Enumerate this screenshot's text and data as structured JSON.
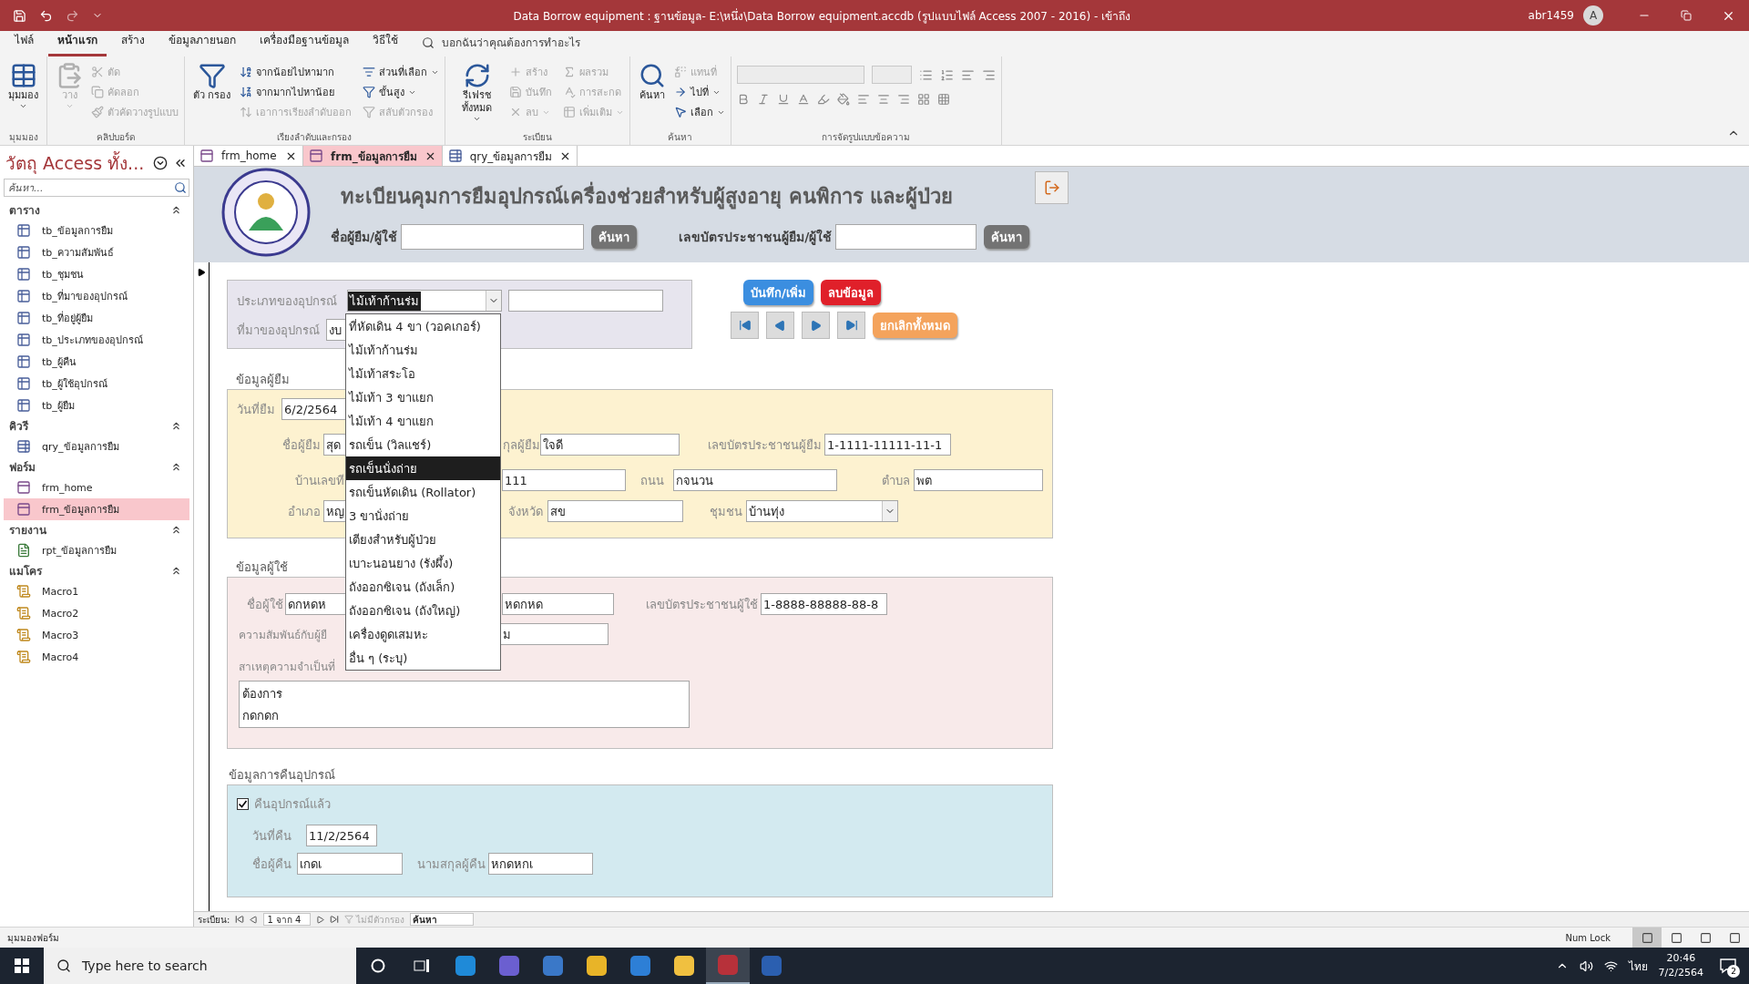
{
  "title_bar": {
    "title": "Data Borrow equipment : ฐานข้อมูล- E:\\หนึ่ง\\Data Borrow equipment.accdb (รูปแบบไฟล์ Access 2007 - 2016)  -  เข้าถึง",
    "user": "abr1459",
    "avatar": "A"
  },
  "ribbon": {
    "tabs": [
      {
        "label": "ไฟล์",
        "selected": false
      },
      {
        "label": "หน้าแรก",
        "selected": true
      },
      {
        "label": "สร้าง",
        "selected": false
      },
      {
        "label": "ข้อมูลภายนอก",
        "selected": false
      },
      {
        "label": "เครื่องมือฐานข้อมูล",
        "selected": false
      },
      {
        "label": "วิธีใช้",
        "selected": false
      }
    ],
    "tell_me": "บอกฉันว่าคุณต้องการทำอะไร",
    "groups": [
      {
        "label": "มุมมอง",
        "items": [
          {
            "kind": "large",
            "label": "มุมมอง",
            "disabled": false,
            "menu": true
          }
        ]
      },
      {
        "label": "คลิปบอร์ด",
        "items": [
          {
            "kind": "large",
            "label": "วาง",
            "disabled": true,
            "menu": true
          },
          {
            "kind": "small",
            "label": "ตัด",
            "disabled": true,
            "menu": false
          },
          {
            "kind": "small",
            "label": "คัดลอก",
            "disabled": true,
            "menu": false
          },
          {
            "kind": "small",
            "label": "ตัวคัดวางรูปแบบ",
            "disabled": true,
            "menu": false
          }
        ]
      },
      {
        "label": "เรียงลำดับและกรอง",
        "items": [
          {
            "kind": "large",
            "label": "ตัว กรอง",
            "disabled": false,
            "menu": false
          },
          {
            "kind": "small",
            "label": "จากน้อยไปหามาก",
            "disabled": false,
            "menu": false
          },
          {
            "kind": "small",
            "label": "จากมากไปหาน้อย",
            "disabled": false,
            "menu": false
          },
          {
            "kind": "small",
            "label": "เอาการเรียงลำดับออก",
            "disabled": true,
            "menu": false
          },
          {
            "kind": "small",
            "label": "ส่วนที่เลือก",
            "disabled": false,
            "menu": true
          },
          {
            "kind": "small",
            "label": "ขั้นสูง",
            "disabled": false,
            "menu": true
          },
          {
            "kind": "small",
            "label": "สลับตัวกรอง",
            "disabled": true,
            "menu": false
          }
        ]
      },
      {
        "label": "ระเบียน",
        "items": [
          {
            "kind": "large",
            "label": "รีเฟรช ทั้งหมด",
            "disabled": false,
            "menu": true
          },
          {
            "kind": "small",
            "label": "สร้าง",
            "disabled": true,
            "menu": false
          },
          {
            "kind": "small",
            "label": "บันทึก",
            "disabled": true,
            "menu": false
          },
          {
            "kind": "small",
            "label": "ลบ",
            "disabled": true,
            "menu": true
          },
          {
            "kind": "small",
            "label": "ผลรวม",
            "disabled": true,
            "menu": false
          },
          {
            "kind": "small",
            "label": "การสะกด",
            "disabled": true,
            "menu": false
          },
          {
            "kind": "small",
            "label": "เพิ่มเติม",
            "disabled": true,
            "menu": true
          }
        ]
      },
      {
        "label": "ค้นหา",
        "items": [
          {
            "kind": "large",
            "label": "ค้นหา",
            "disabled": false,
            "menu": false
          },
          {
            "kind": "small",
            "label": "แทนที่",
            "disabled": true,
            "menu": false
          },
          {
            "kind": "small",
            "label": "ไปที่",
            "disabled": false,
            "menu": true
          },
          {
            "kind": "small",
            "label": "เลือก",
            "disabled": false,
            "menu": true
          }
        ]
      },
      {
        "label": "การจัดรูปแบบข้อความ",
        "items": [
          {
            "kind": "formatting"
          }
        ]
      }
    ]
  },
  "nav_pane": {
    "title": "วัตถุ Access ทั้ง...",
    "search_placeholder": "ค้นหา...",
    "groups": [
      {
        "label": "ตาราง",
        "items": [
          {
            "kind": "table",
            "label": "tb_ข้อมูลการยืม",
            "selected": false
          },
          {
            "kind": "table",
            "label": "tb_ความสัมพันธ์",
            "selected": false
          },
          {
            "kind": "table",
            "label": "tb_ชุมชน",
            "selected": false
          },
          {
            "kind": "table",
            "label": "tb_ที่มาของอุปกรณ์",
            "selected": false
          },
          {
            "kind": "table",
            "label": "tb_ที่อยู่ผู้ยืม",
            "selected": false
          },
          {
            "kind": "table",
            "label": "tb_ประเภทของอุปกรณ์",
            "selected": false
          },
          {
            "kind": "table",
            "label": "tb_ผู้คืน",
            "selected": false
          },
          {
            "kind": "table",
            "label": "tb_ผู้ใช้อุปกรณ์",
            "selected": false
          },
          {
            "kind": "table",
            "label": "tb_ผู้ยืม",
            "selected": false
          }
        ]
      },
      {
        "label": "คิวรี",
        "items": [
          {
            "kind": "query",
            "label": "qry_ข้อมูลการยืม",
            "selected": false
          }
        ]
      },
      {
        "label": "ฟอร์ม",
        "items": [
          {
            "kind": "form",
            "label": "frm_home",
            "selected": false
          },
          {
            "kind": "form",
            "label": "frm_ข้อมูลการยืม",
            "selected": true
          }
        ]
      },
      {
        "label": "รายงาน",
        "items": [
          {
            "kind": "report",
            "label": "rpt_ข้อมูลการยืม",
            "selected": false
          }
        ]
      },
      {
        "label": "แมโคร",
        "items": [
          {
            "kind": "macro",
            "label": "Macro1",
            "selected": false
          },
          {
            "kind": "macro",
            "label": "Macro2",
            "selected": false
          },
          {
            "kind": "macro",
            "label": "Macro3",
            "selected": false
          },
          {
            "kind": "macro",
            "label": "Macro4",
            "selected": false
          }
        ]
      }
    ]
  },
  "doc_tabs": [
    {
      "label": "frm_home",
      "kind": "form",
      "selected": false
    },
    {
      "label": "frm_ข้อมูลการยืม",
      "kind": "form",
      "selected": true
    },
    {
      "label": "qry_ข้อมูลการยืม",
      "kind": "query",
      "selected": false
    }
  ],
  "form": {
    "header": {
      "title": "ทะเบียนคุมการยืมอุปกรณ์เครื่องช่วยสำหรับผู้สูงอายุ คนพิการ และผู้ป่วย",
      "searches": [
        {
          "label": "ชื่อผู้ยืม/ผู้ใช้",
          "button": "ค้นหา"
        },
        {
          "label": "เลขบัตรประชาชนผู้ยืม/ผู้ใช้",
          "button": "ค้นหา"
        }
      ]
    },
    "equipment": {
      "type_label": "ประเภทของอุปกรณ์",
      "type_value": "ไม้เท้าก้านร่ม",
      "source_label": "ที่มาของอุปกรณ์",
      "source_value": "งบ"
    },
    "actions": {
      "save": "บันทึก/เพิ่ม",
      "delete": "ลบข้อมูล",
      "cancel": "ยกเลิกทั้งหมด"
    },
    "borrower": {
      "heading": "ข้อมูลผู้ยืม",
      "date_label": "วันที่ยืม",
      "date": "6/2/2564",
      "name_label": "ชื่อผู้ยืม",
      "name": "สุด",
      "surname_label": "กุลผู้ยืม",
      "surname": "ใจดี",
      "id_label": "เลขบัตรประชาชนผู้ยืม",
      "id": "1-1111-11111-11-1",
      "house_label": "บ้านเลขที",
      "house": "111",
      "road_label": "ถนน",
      "road": "กจนวน",
      "subdistrict_label": "ตำบล",
      "subdistrict": "พต",
      "district_label": "อำเภอ",
      "district": "หญ",
      "province_label": "จังหวัด",
      "province": "สข",
      "community_label": "ชุมชน",
      "community": "บ้านทุ่ง"
    },
    "user": {
      "heading": "ข้อมูลผู้ใช้",
      "name_label": "ชื่อผู้ใช้",
      "name": "ดกหดห",
      "surname": "หดกหด",
      "id_label": "เลขบัตรประชาชนผู้ใช้",
      "id": "1-8888-88888-88-8",
      "relation_label": "ความสัมพันธ์กับผู้ยื",
      "relation": "ม",
      "reason_label": "สาเหตุความจำเป็นที่",
      "reason_lines": [
        "ต้องการ",
        "กดกดก"
      ]
    },
    "return": {
      "heading": "ข้อมูลการคืนอุปกรณ์",
      "returned_label": "คืนอุปกรณ์แล้ว",
      "returned": true,
      "date_label": "วันที่คืน",
      "date": "11/2/2564",
      "name_label": "ชื่อผู้คืน",
      "name": "เกดเ",
      "surname_label": "นามสกุลผู้คืน",
      "surname": "หกดหกเ"
    },
    "dropdown": {
      "options": [
        {
          "label": "ที่หัดเดิน 4 ขา (วอคเกอร์)",
          "selected": false
        },
        {
          "label": "ไม้เท้าก้านร่ม",
          "selected": false
        },
        {
          "label": "ไม้เท้าสระโอ",
          "selected": false
        },
        {
          "label": "ไม้เท้า 3 ขาแยก",
          "selected": false
        },
        {
          "label": "ไม้เท้า 4 ขาแยก",
          "selected": false
        },
        {
          "label": "รถเข็น (วิลแชร์)",
          "selected": false
        },
        {
          "label": "รถเข็นนั่งถ่าย",
          "selected": true
        },
        {
          "label": "รถเข็นหัดเดิน (Rollator)",
          "selected": false
        },
        {
          "label": "3 ขานั่งถ่าย",
          "selected": false
        },
        {
          "label": "เตียงสำหรับผู้ป่วย",
          "selected": false
        },
        {
          "label": "เบาะนอนยาง (รังผึ้ง)",
          "selected": false
        },
        {
          "label": "ถังออกซิเจน (ถังเล็ก)",
          "selected": false
        },
        {
          "label": "ถังออกซิเจน (ถังใหญ่)",
          "selected": false
        },
        {
          "label": "เครื่องดูดเสมหะ",
          "selected": false
        },
        {
          "label": "อื่น ๆ (ระบุ)",
          "selected": false
        }
      ]
    },
    "record_nav": {
      "label": "ระเบียน:",
      "position": "1 จาก 4",
      "filter": "ไม่มีตัวกรอง",
      "search_placeholder": "ค้นหา"
    }
  },
  "status_bar": {
    "view": "มุมมองฟอร์ม",
    "num_lock": "Num Lock",
    "views": [
      {
        "selected": true
      },
      {
        "selected": false
      },
      {
        "selected": false
      },
      {
        "selected": false
      }
    ]
  },
  "taskbar": {
    "search_placeholder": "Type here to search",
    "apps": [
      {
        "selected": false
      },
      {
        "selected": false
      },
      {
        "selected": false
      },
      {
        "selected": false
      },
      {
        "selected": false
      },
      {
        "selected": false
      },
      {
        "selected": true
      },
      {
        "selected": false
      }
    ],
    "language": "ไทย",
    "time": "20:46",
    "date": "7/2/2564",
    "notifications": "2"
  }
}
